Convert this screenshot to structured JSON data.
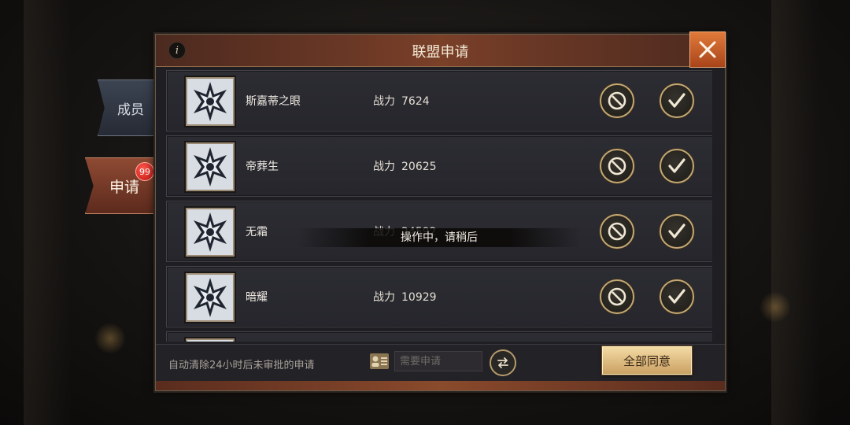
{
  "tabs": {
    "members": "成员",
    "apply": "申请",
    "apply_badge": "99"
  },
  "dialog": {
    "title": "联盟申请",
    "info_icon": "i"
  },
  "applicants": [
    {
      "name": "斯嘉蒂之眼",
      "power_label": "战力",
      "power": "7624"
    },
    {
      "name": "帝葬生",
      "power_label": "战力",
      "power": "20625"
    },
    {
      "name": "无霜",
      "power_label": "战力",
      "power": "24592"
    },
    {
      "name": "暗耀",
      "power_label": "战力",
      "power": "10929"
    }
  ],
  "toast": "操作中，请稍后",
  "footer": {
    "note": "自动清除24小时后未审批的申请",
    "need_placeholder": "需要申请",
    "approve_all": "全部同意"
  },
  "colors": {
    "accent_gold": "#c4a873",
    "header_brown": "#6b3826",
    "close_orange": "#e07a3a",
    "badge_red": "#c3120b"
  },
  "icons": {
    "info": "info-icon",
    "close": "close-icon",
    "reject": "prohibit-icon",
    "approve": "checkmark-icon",
    "swap": "swap-arrows-icon",
    "need": "id-card-icon",
    "avatar": "star-emblem-icon"
  }
}
